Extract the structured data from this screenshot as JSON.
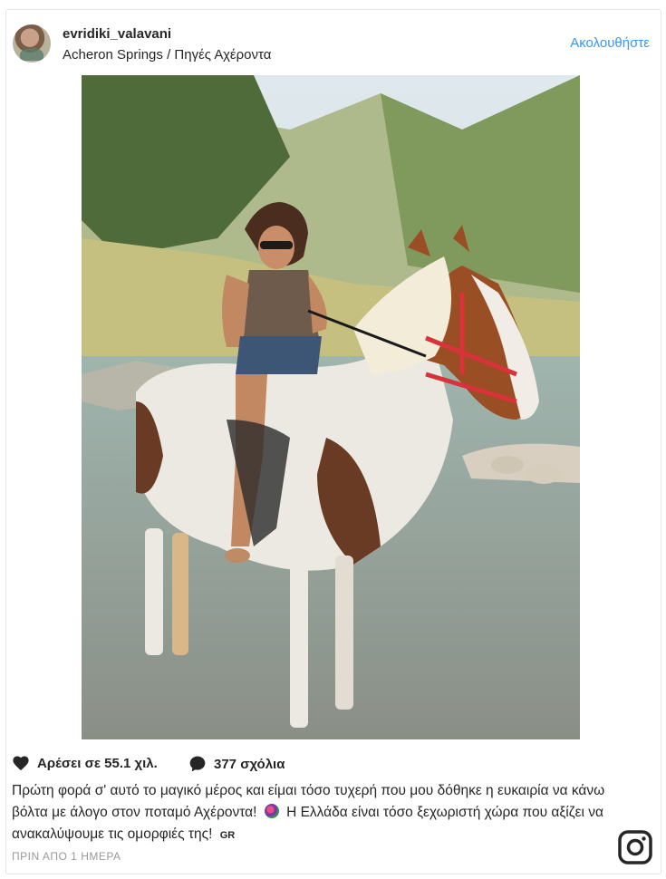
{
  "header": {
    "username": "evridiki_valavani",
    "location": "Acheron Springs / Πηγές Αχέροντα",
    "follow_label": "Ακολουθήστε"
  },
  "photo": {
    "alt": "Woman riding a brown and white horse in a shallow river"
  },
  "actions": {
    "likes_label": "Αρέσει σε 55.1 χιλ.",
    "comments_label": "377 σχόλια"
  },
  "caption": {
    "text_1": "Πρώτη φορά σ' αυτό το μαγικό μέρος και είμαι τόσο τυχερή που μου δόθηκε η ευκαιρία να κάνω βόλτα με άλογο στον ποταμό Αχέροντα!",
    "text_2": "Η Ελλάδα είναι τόσο ξεχωριστή χώρα που αξίζει να ανακαλύψουμε τις ομορφιές της!",
    "tag": "GR"
  },
  "timestamp": "ΠΡΙΝ ΑΠΟ 1 ΗΜΕΡΑ",
  "icons": {
    "heart": "heart-icon",
    "comment": "comment-icon",
    "instagram": "instagram-icon"
  }
}
